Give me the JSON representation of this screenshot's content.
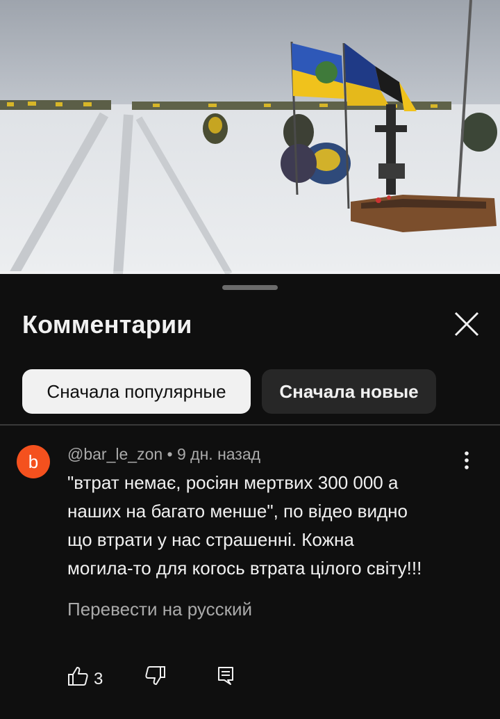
{
  "video": {
    "thumbnail_icon": "video-frame-cemetery-flags",
    "progress": 0.09
  },
  "comments_sheet": {
    "title": "Комментарии",
    "close_icon": "close-icon",
    "sort_chips": [
      {
        "label": "Сначала популярные",
        "selected": true
      },
      {
        "label": "Сначала новые",
        "selected": false
      }
    ]
  },
  "comment": {
    "avatar_letter": "b",
    "avatar_color": "#f4511e",
    "meta": "@bar_le_zon • 9 дн. назад",
    "lines": [
      "\"втрат немає, росіян мертвих 300 000 а",
      "наших на багато менше\", по відео видно",
      "що втрати у нас страшенні. Кожна",
      "могила-то для когось втрата цілого світу!!!"
    ],
    "translate_label": "Перевести на русский",
    "like_count": "3"
  },
  "colors": {
    "background": "#0f0f0f",
    "chip_active": "#f1f1f1",
    "chip_idle": "#272727",
    "secondary_text": "#aaaaaa"
  }
}
